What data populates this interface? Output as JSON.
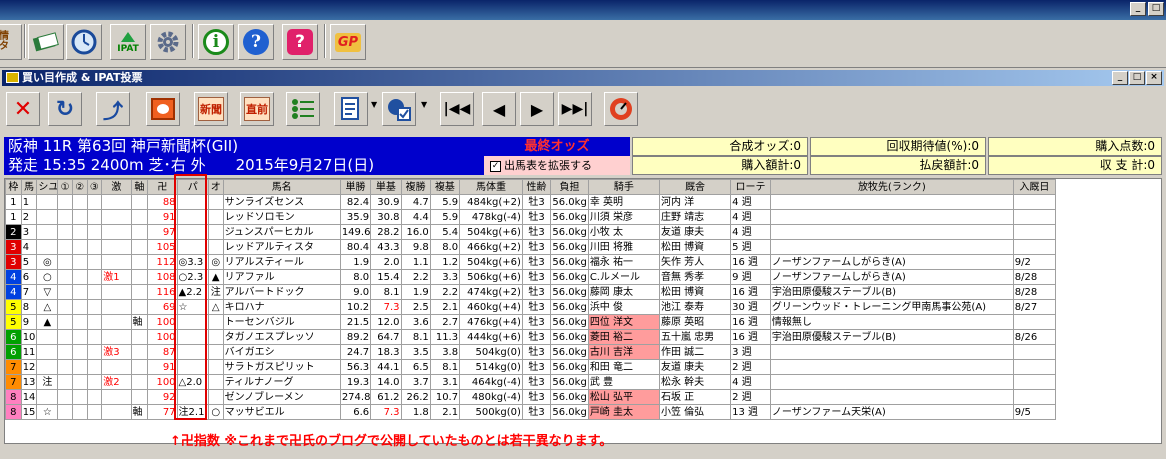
{
  "colors": {
    "accent_blue": "#0000cc",
    "red": "#ff0000",
    "yellow_panel": "#ffffc0",
    "pink": "#ff9c9c"
  },
  "toolbar1": {
    "icons": [
      "data-icon",
      "cash-icon",
      "clock-icon",
      "ipat-icon",
      "gear-icon",
      "info-icon",
      "help-icon",
      "question-icon",
      "gp-icon"
    ],
    "ipat": "IPAT",
    "gp": "GP",
    "data_label": "情\nタ"
  },
  "window": {
    "title": "買い目作成 & IPAT投票"
  },
  "toolbar2": {
    "icons": [
      "close-x-icon",
      "refresh-icon",
      "undo-icon",
      "photo-icon",
      "newspaper-icon",
      "direct-icon",
      "list-icon",
      "memo-icon",
      "vote-icon",
      "first-icon",
      "prev-icon",
      "next-icon",
      "last-icon",
      "gauge-icon"
    ],
    "news": "新聞",
    "direct": "直前"
  },
  "race": {
    "line1": "阪神 11R 第63回 神戸新聞杯(GII)",
    "line2": "発走 15:35 2400m 芝･右 外　　2015年9月27日(日)"
  },
  "final_odds": "最終オッズ",
  "expand_label": "出馬表を拡張する",
  "stats": {
    "combined_odds": "合成オッズ:0",
    "expected": "回収期待値(%):0",
    "points": "購入点数:0",
    "purchase": "購入額計:0",
    "refund": "払戻額計:0",
    "balance": "収 支 計:0"
  },
  "headers": [
    "枠",
    "馬",
    "シユ",
    "①",
    "②",
    "③",
    "激",
    "軸",
    "卍",
    "パ",
    "オ",
    "馬名",
    "単勝",
    "単基",
    "複勝",
    "複基",
    "馬体重",
    "性齢",
    "負担",
    "騎手",
    "厩舎",
    "ローテ",
    "放牧先(ランク)",
    "入厩日"
  ],
  "rows": [
    [
      "1",
      "1",
      "",
      "",
      "",
      "",
      "",
      "",
      "88",
      "",
      "",
      "サンライズセンス",
      "82.4",
      "30.9",
      "4.7",
      "5.9",
      "484kg(+2)",
      "牡3",
      "56.0kg",
      "幸 英明",
      "河内 洋",
      "4 週",
      "",
      ""
    ],
    [
      "1",
      "2",
      "",
      "",
      "",
      "",
      "",
      "",
      "91",
      "",
      "",
      "レッドソロモン",
      "35.9",
      "30.8",
      "4.4",
      "5.9",
      "478kg(-4)",
      "牡3",
      "56.0kg",
      "川須 栄彦",
      "庄野 靖志",
      "4 週",
      "",
      ""
    ],
    [
      "2",
      "3",
      "",
      "",
      "",
      "",
      "",
      "",
      "97",
      "",
      "",
      "ジュンスパーヒカル",
      "149.6",
      "28.2",
      "16.0",
      "5.4",
      "504kg(+6)",
      "牡3",
      "56.0kg",
      "小牧 太",
      "友道 康夫",
      "4 週",
      "",
      ""
    ],
    [
      "3",
      "4",
      "",
      "",
      "",
      "",
      "",
      "",
      "105",
      "",
      "",
      "レッドアルティスタ",
      "80.4",
      "43.3",
      "9.8",
      "8.0",
      "466kg(+2)",
      "牡3",
      "56.0kg",
      "川田 将雅",
      "松田 博資",
      "5 週",
      "",
      ""
    ],
    [
      "3",
      "5",
      "◎",
      "",
      "",
      "",
      "",
      "",
      "112",
      "◎3.3",
      "◎",
      "リアルスティール",
      "1.9",
      "2.0",
      "1.1",
      "1.2",
      "504kg(+6)",
      "牡3",
      "56.0kg",
      "福永 祐一",
      "矢作 芳人",
      "16 週",
      "ノーザンファームしがらき(A)",
      "9/2"
    ],
    [
      "4",
      "6",
      "○",
      "",
      "",
      "",
      "激1",
      "",
      "108",
      "○2.3",
      "▲",
      "リアファル",
      "8.0",
      "15.4",
      "2.2",
      "3.3",
      "506kg(+6)",
      "牡3",
      "56.0kg",
      "C.ルメール",
      "音無 秀孝",
      "9 週",
      "ノーザンファームしがらき(A)",
      "8/28"
    ],
    [
      "4",
      "7",
      "▽",
      "",
      "",
      "",
      "",
      "",
      "116",
      "▲2.2",
      "注",
      "アルバートドック",
      "9.0",
      "8.1",
      "1.9",
      "2.2",
      "474kg(+2)",
      "牡3",
      "56.0kg",
      "藤岡 康太",
      "松田 博資",
      "16 週",
      "宇治田原優駿ステーブル(B)",
      "8/28"
    ],
    [
      "5",
      "8",
      "△",
      "",
      "",
      "",
      "",
      "",
      "69",
      "☆",
      "△",
      "キロハナ",
      "10.2",
      "7.3",
      "2.5",
      "2.1",
      "460kg(+4)",
      "牡3",
      "56.0kg",
      "浜中 俊",
      "池江 泰寿",
      "30 週",
      "グリーンウッド・トレーニング甲南馬事公苑(A)",
      "8/27"
    ],
    [
      "5",
      "9",
      "▲",
      "",
      "",
      "",
      "",
      "軸",
      "100",
      "",
      "",
      "トーセンバジル",
      "21.5",
      "12.0",
      "3.6",
      "2.7",
      "476kg(+4)",
      "牡3",
      "56.0kg",
      "四位 洋文",
      "藤原 英昭",
      "16 週",
      "情報無し",
      ""
    ],
    [
      "6",
      "10",
      "",
      "",
      "",
      "",
      "",
      "",
      "100",
      "",
      "",
      "タガノエスプレッソ",
      "89.2",
      "64.7",
      "8.1",
      "11.3",
      "444kg(+6)",
      "牡3",
      "56.0kg",
      "菱田 裕二",
      "五十嵐 忠男",
      "16 週",
      "宇治田原優駿ステーブル(B)",
      "8/26"
    ],
    [
      "6",
      "11",
      "",
      "",
      "",
      "",
      "激3",
      "",
      "87",
      "",
      "",
      "バイガエシ",
      "24.7",
      "18.3",
      "3.5",
      "3.8",
      "504kg(0)",
      "牡3",
      "56.0kg",
      "古川 吉洋",
      "作田 誠二",
      "3 週",
      "",
      ""
    ],
    [
      "7",
      "12",
      "",
      "",
      "",
      "",
      "",
      "",
      "91",
      "",
      "",
      "サラトガスピリット",
      "56.3",
      "44.1",
      "6.5",
      "8.1",
      "514kg(0)",
      "牡3",
      "56.0kg",
      "和田 竜二",
      "友道 康夫",
      "2 週",
      "",
      ""
    ],
    [
      "7",
      "13",
      "注",
      "",
      "",
      "",
      "激2",
      "",
      "100",
      "△2.0",
      "",
      "ティルナノーグ",
      "19.3",
      "14.0",
      "3.7",
      "3.1",
      "464kg(-4)",
      "牡3",
      "56.0kg",
      "武 豊",
      "松永 幹夫",
      "4 週",
      "",
      ""
    ],
    [
      "8",
      "14",
      "",
      "",
      "",
      "",
      "",
      "",
      "92",
      "",
      "",
      "ゼンノブレーメン",
      "274.8",
      "61.2",
      "26.2",
      "10.7",
      "480kg(-4)",
      "牡3",
      "56.0kg",
      "松山 弘平",
      "石坂 正",
      "2 週",
      "",
      ""
    ],
    [
      "8",
      "15",
      "☆",
      "",
      "",
      "",
      "",
      "軸",
      "77",
      "注2.1",
      "○",
      "マッサビエル",
      "6.6",
      "7.3",
      "1.8",
      "2.1",
      "500kg(0)",
      "牡3",
      "56.0kg",
      "戸崎 圭太",
      "小笠 倫弘",
      "13 週",
      "ノーザンファーム天栄(A)",
      "9/5"
    ]
  ],
  "red_tanki_rows": [
    7,
    14
  ],
  "pink_jockey_rows": [
    8,
    9,
    10,
    13,
    14
  ],
  "caption": "↑卍指数 ※これまで卍氏のブログで公開していたものとは若干異なります。"
}
